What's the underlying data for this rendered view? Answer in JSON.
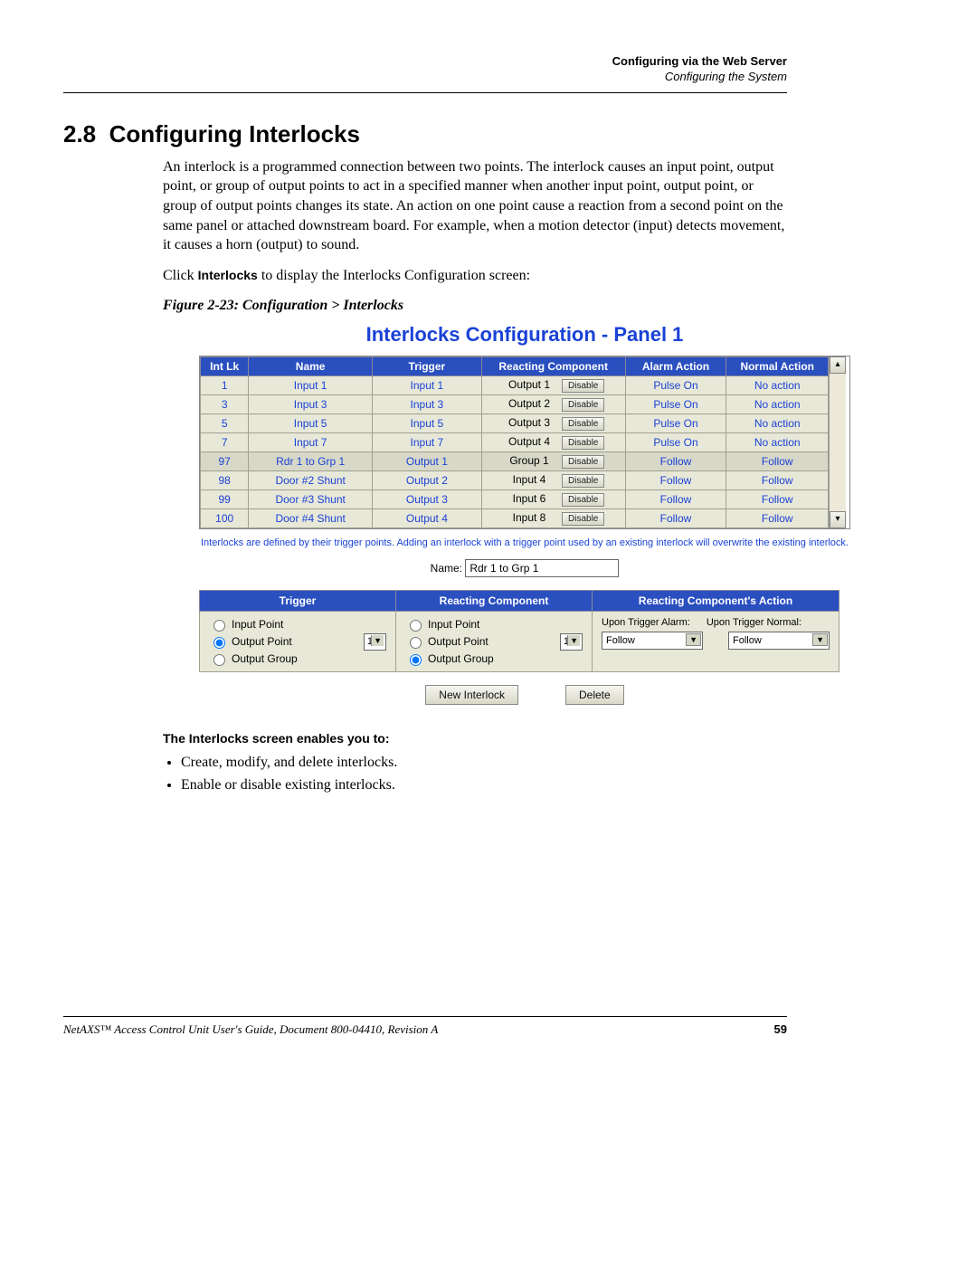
{
  "header": {
    "line1": "Configuring via the Web Server",
    "line2": "Configuring the System"
  },
  "section_number": "2.8",
  "section_title": "Configuring Interlocks",
  "para1": "An interlock is a programmed connection between two points. The interlock causes an input point, output point, or group of output points to act in a specified manner when another input point, output point, or group of output points changes its state. An action on one point cause a reaction from a second point on the same panel or attached downstream board. For example, when a motion detector (input) detects movement, it causes a horn (output) to sound.",
  "para2_pre": "Click ",
  "para2_bold": "Interlocks",
  "para2_post": " to display the Interlocks Configuration screen:",
  "figure_caption": "Figure 2-23:   Configuration > Interlocks",
  "panel_title": "Interlocks Configuration - Panel 1",
  "table": {
    "headers": [
      "Int Lk",
      "Name",
      "Trigger",
      "Reacting Component",
      "Alarm Action",
      "Normal Action"
    ],
    "rows": [
      {
        "id": "1",
        "name": "Input 1",
        "trigger": "Input 1",
        "react": "Output 1",
        "alarm": "Pulse On",
        "normal": "No action"
      },
      {
        "id": "3",
        "name": "Input 3",
        "trigger": "Input 3",
        "react": "Output 2",
        "alarm": "Pulse On",
        "normal": "No action"
      },
      {
        "id": "5",
        "name": "Input 5",
        "trigger": "Input 5",
        "react": "Output 3",
        "alarm": "Pulse On",
        "normal": "No action"
      },
      {
        "id": "7",
        "name": "Input 7",
        "trigger": "Input 7",
        "react": "Output 4",
        "alarm": "Pulse On",
        "normal": "No action"
      },
      {
        "id": "97",
        "name": "Rdr 1 to Grp 1",
        "trigger": "Output 1",
        "react": "Group 1",
        "alarm": "Follow",
        "normal": "Follow",
        "selected": true
      },
      {
        "id": "98",
        "name": "Door #2 Shunt",
        "trigger": "Output 2",
        "react": "Input 4",
        "alarm": "Follow",
        "normal": "Follow"
      },
      {
        "id": "99",
        "name": "Door #3 Shunt",
        "trigger": "Output 3",
        "react": "Input 6",
        "alarm": "Follow",
        "normal": "Follow"
      },
      {
        "id": "100",
        "name": "Door #4 Shunt",
        "trigger": "Output 4",
        "react": "Input 8",
        "alarm": "Follow",
        "normal": "Follow"
      }
    ],
    "disable_label": "Disable"
  },
  "hint": "Interlocks are defined by their trigger points. Adding an interlock with a trigger point used by an existing interlock will overwrite the existing interlock.",
  "name_label": "Name:",
  "name_value": "Rdr 1 to Grp 1",
  "edit": {
    "headers": [
      "Trigger",
      "Reacting Component",
      "Reacting Component's Action"
    ],
    "trigger": {
      "options": [
        "Input Point",
        "Output Point",
        "Output Group"
      ],
      "selected": "Output Point",
      "num": "1"
    },
    "reacting": {
      "options": [
        "Input Point",
        "Output Point",
        "Output Group"
      ],
      "selected": "Output Group",
      "num": "1"
    },
    "action": {
      "label_alarm": "Upon Trigger Alarm:",
      "label_normal": "Upon Trigger Normal:",
      "alarm_value": "Follow",
      "normal_value": "Follow"
    }
  },
  "buttons": {
    "new": "New Interlock",
    "delete": "Delete"
  },
  "sub_heading": "The Interlocks screen enables you to:",
  "bullets": [
    "Create, modify, and delete interlocks.",
    "Enable or disable existing interlocks."
  ],
  "footer": {
    "doc": "NetAXS™ Access Control Unit User's Guide, Document 800-04410, Revision A",
    "page": "59"
  }
}
